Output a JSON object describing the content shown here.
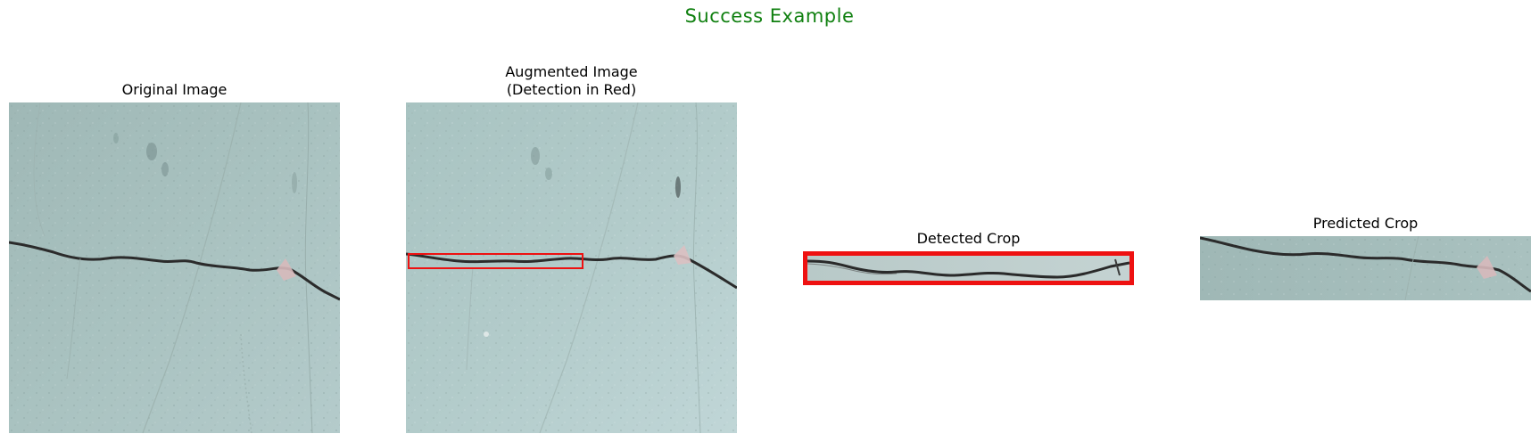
{
  "figure": {
    "title": "Success Example",
    "title_color": "#108010",
    "detection_color": "#ee1111"
  },
  "panels": [
    {
      "title": "Original Image"
    },
    {
      "title": "Augmented Image\n(Detection in Red)"
    },
    {
      "title": "Detected Crop"
    },
    {
      "title": "Predicted Crop"
    }
  ]
}
